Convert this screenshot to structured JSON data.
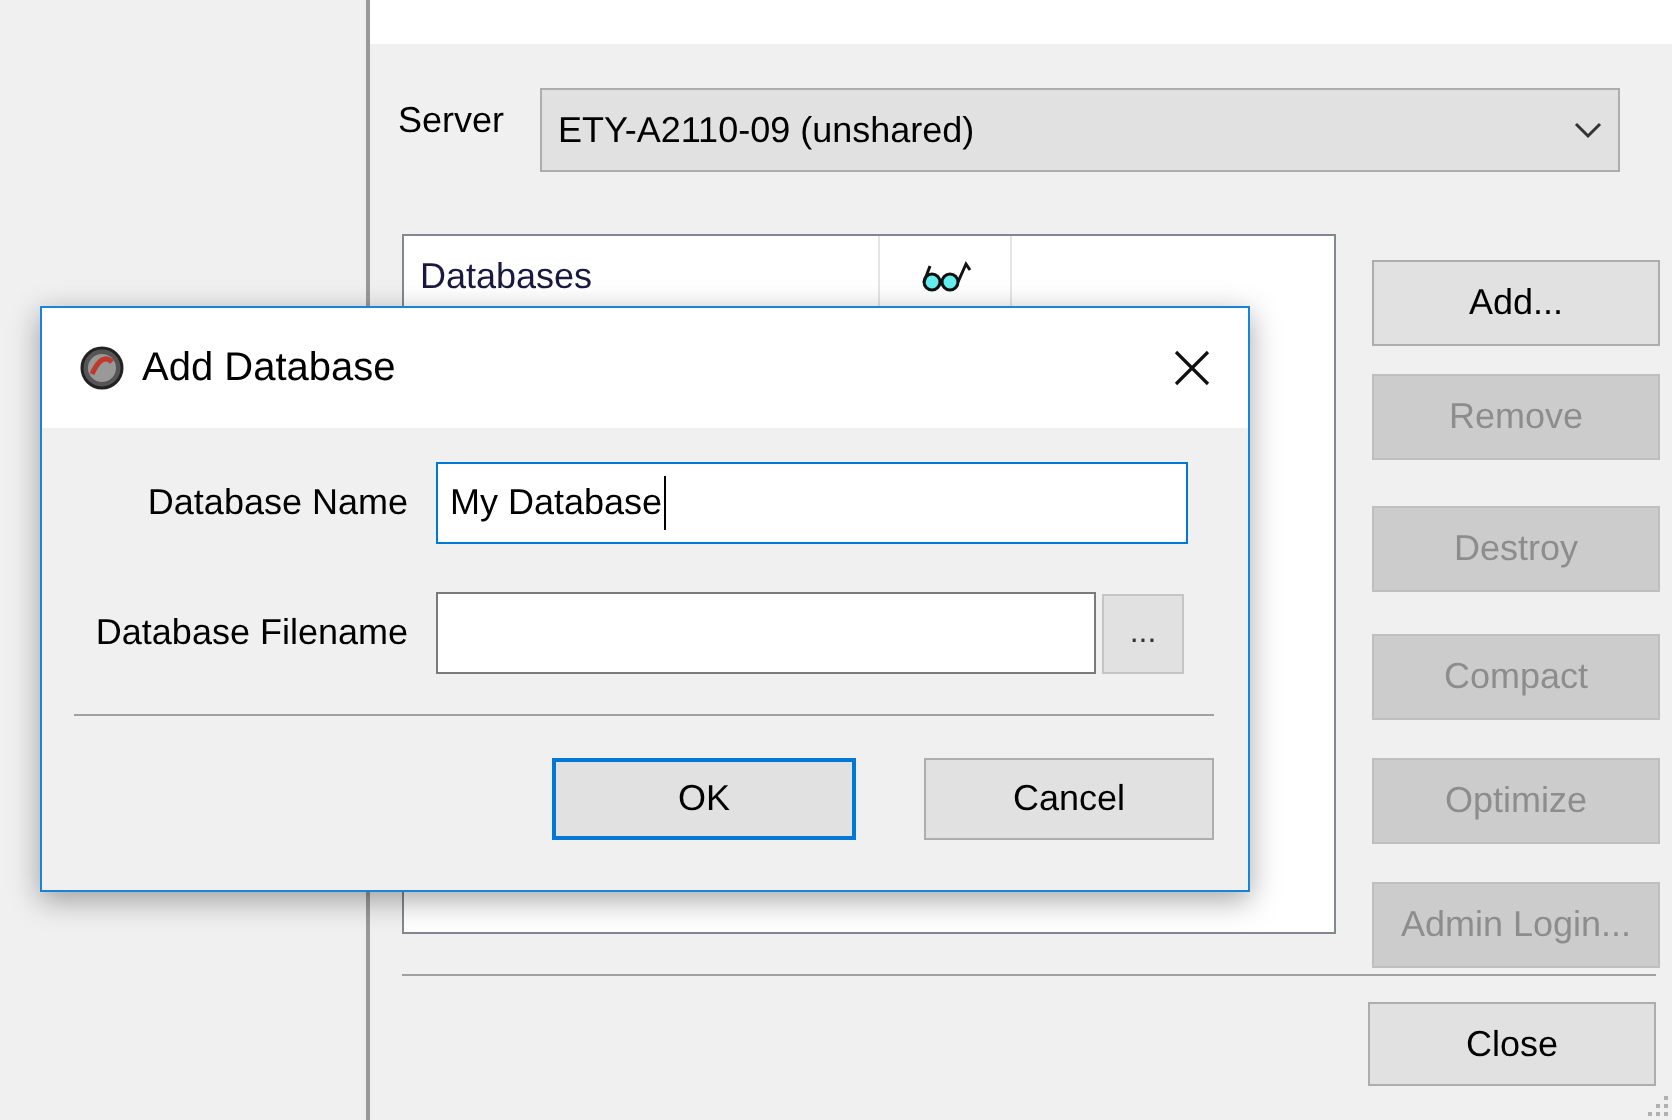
{
  "background_window": {
    "server": {
      "label": "Server",
      "value": "ETY-A2110-09 (unshared)"
    },
    "list": {
      "columns": [
        {
          "kind": "text",
          "label": "Databases"
        },
        {
          "kind": "icon"
        }
      ]
    },
    "buttons": [
      {
        "label": "Add...",
        "disabled": false
      },
      {
        "label": "Remove",
        "disabled": true
      },
      {
        "label": "Destroy",
        "disabled": true
      },
      {
        "label": "Compact",
        "disabled": true
      },
      {
        "label": "Optimize",
        "disabled": true
      },
      {
        "label": "Admin Login...",
        "disabled": true
      }
    ],
    "close_button": "Close"
  },
  "dialog": {
    "title": "Add Database",
    "fields": [
      {
        "kind": "text",
        "label": "Database Name",
        "value": "My Database",
        "focused": true
      },
      {
        "kind": "file",
        "label": "Database Filename",
        "focused": false,
        "browse_button": "..."
      }
    ],
    "buttons": [
      {
        "label": "OK",
        "default": true
      },
      {
        "label": "Cancel",
        "default": false
      }
    ]
  }
}
